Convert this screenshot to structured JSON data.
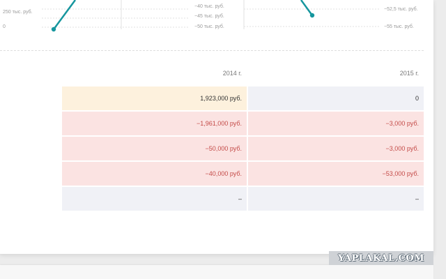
{
  "charts": {
    "left": {
      "y_labels_left": [
        "250 тыс. руб.",
        "0"
      ],
      "y_labels_right": [
        "−40 тыс. руб.",
        "−45 тыс. руб.",
        "−50 тыс. руб."
      ],
      "line_color": "#16969e"
    },
    "right": {
      "y_labels_right": [
        "−52,5 тыс. руб.",
        "−55 тыс. руб."
      ],
      "line_color": "#16969e"
    }
  },
  "table": {
    "columns": [
      "2014 г.",
      "2015 г."
    ],
    "rows": [
      {
        "style": "yellow-grey",
        "values": [
          "1,923,000 руб.",
          "0"
        ]
      },
      {
        "style": "pink",
        "values": [
          "−1,961,000 руб.",
          "−3,000 руб."
        ]
      },
      {
        "style": "pink",
        "values": [
          "−50,000 руб.",
          "−3,000 руб."
        ]
      },
      {
        "style": "pink",
        "values": [
          "−40,000 руб.",
          "−53,000 руб."
        ]
      },
      {
        "style": "grey",
        "values": [
          "–",
          "–"
        ]
      }
    ]
  },
  "colors": {
    "positive_bg": "#fdf1dd",
    "negative_bg": "#fbe3e2",
    "neutral_bg": "#f0f1f6",
    "negative_text": "#c44b48"
  },
  "watermark": {
    "text": "YAPLAKAL.COM"
  }
}
